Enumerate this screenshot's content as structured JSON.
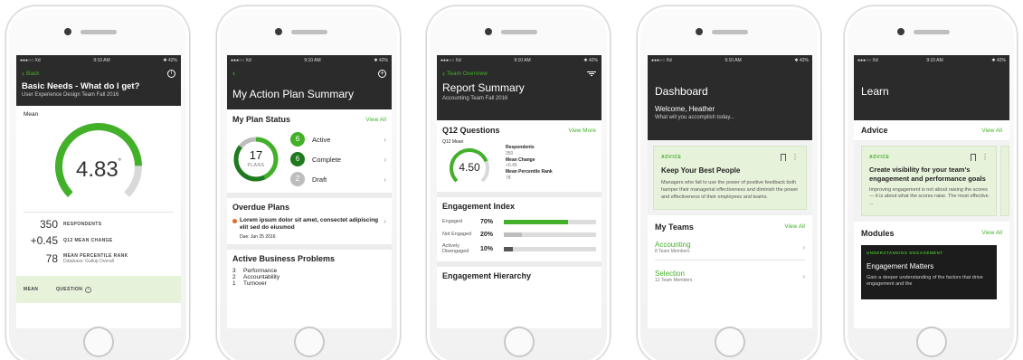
{
  "status": {
    "carrier": "●●●○○ Xd",
    "time": "9:10 AM",
    "battery": "✱ 42%"
  },
  "phone1": {
    "back_label": "Back",
    "title": "Basic Needs - What do I get?",
    "subtitle": "User Experience Design Team Fall 2016",
    "mean_label": "Mean",
    "gauge_value": "4.83",
    "gauge_fraction": 0.83,
    "stats": [
      {
        "value": "350",
        "label": "RESPONDENTS"
      },
      {
        "value": "+0.45",
        "label": "Q12 MEAN CHANGE"
      },
      {
        "value": "78",
        "label": "MEAN PERCENTILE RANK",
        "note": "Database: Gallup Overall"
      }
    ],
    "footer": {
      "mean": "MEAN",
      "question": "QUESTION"
    }
  },
  "phone2": {
    "title": "My Action Plan Summary",
    "plan_status_title": "My Plan Status",
    "view_all": "View All",
    "total_plans": "17",
    "plans_label": "PLANS",
    "statuses": [
      {
        "count": "6",
        "label": "Active",
        "color": "#43b02a"
      },
      {
        "count": "6",
        "label": "Complete",
        "color": "#1f7a1f"
      },
      {
        "count": "2",
        "label": "Draft",
        "color": "#bdbdbd"
      }
    ],
    "overdue_title": "Overdue Plans",
    "overdue_text": "Lorem ipsum dolor sit amet, consectet adipiscing elit sed do eiusmod",
    "overdue_due": "Due: Jun 25 2016",
    "problems_title": "Active Business Problems",
    "problems": [
      {
        "count": "3",
        "label": "Performance"
      },
      {
        "count": "2",
        "label": "Accountability"
      },
      {
        "count": "1",
        "label": "Turnover"
      }
    ]
  },
  "phone3": {
    "back_label": "Team Overview",
    "title": "Report Summary",
    "subtitle": "Accounting Team Fall 2016",
    "q12_title": "Q12 Questions",
    "view_more": "View More",
    "q12_mean_label": "Q12 Mean",
    "q12_value": "4.50",
    "q12_fraction": 0.75,
    "details": [
      {
        "label": "Respondents",
        "value": "350"
      },
      {
        "label": "Mean Change",
        "value": "+0.45"
      },
      {
        "label": "Mean Percentile Rank",
        "value": "78"
      }
    ],
    "engagement_title": "Engagement Index",
    "engagement": [
      {
        "label": "Engaged",
        "pct": "70%",
        "fraction": 0.7,
        "color": "#43b02a"
      },
      {
        "label": "Not Engaged",
        "pct": "20%",
        "fraction": 0.2,
        "color": "#bdbdbd"
      },
      {
        "label": "Actively Disengaged",
        "pct": "10%",
        "fraction": 0.1,
        "color": "#555555"
      }
    ],
    "hierarchy_title": "Engagement Hierarchy"
  },
  "phone4": {
    "title": "Dashboard",
    "welcome": "Welcome, Heather",
    "prompt": "What will you accomplish today...",
    "advice_tag": "ADVICE",
    "card_title": "Keep Your Best People",
    "card_body": "Managers who fail to use the power of positive feedback both hamper their managerial effectiveness and diminish the power and effectiveness of their employees and teams.",
    "teams_title": "My Teams",
    "view_all": "View All",
    "teams": [
      {
        "name": "Accounting",
        "members": "8 Team Members"
      },
      {
        "name": "Selection",
        "members": "12 Team Members"
      }
    ]
  },
  "phone5": {
    "title": "Learn",
    "advice_title": "Advice",
    "view_all": "View All",
    "advice_tag": "ADVICE",
    "card_title": "Create visibility for your team's engagement and performance goals",
    "card_body": "Improving engagement is not about raising the scores — it is about what the scores raise. The most effective ...",
    "modules_title": "Modules",
    "modules_view_all": "View All",
    "module_tag": "UNDERSTANDING ENGAGEMENT",
    "module_title": "Engagement Matters",
    "module_body": "Gain a deeper understanding of the factors that drive engagement and the"
  }
}
